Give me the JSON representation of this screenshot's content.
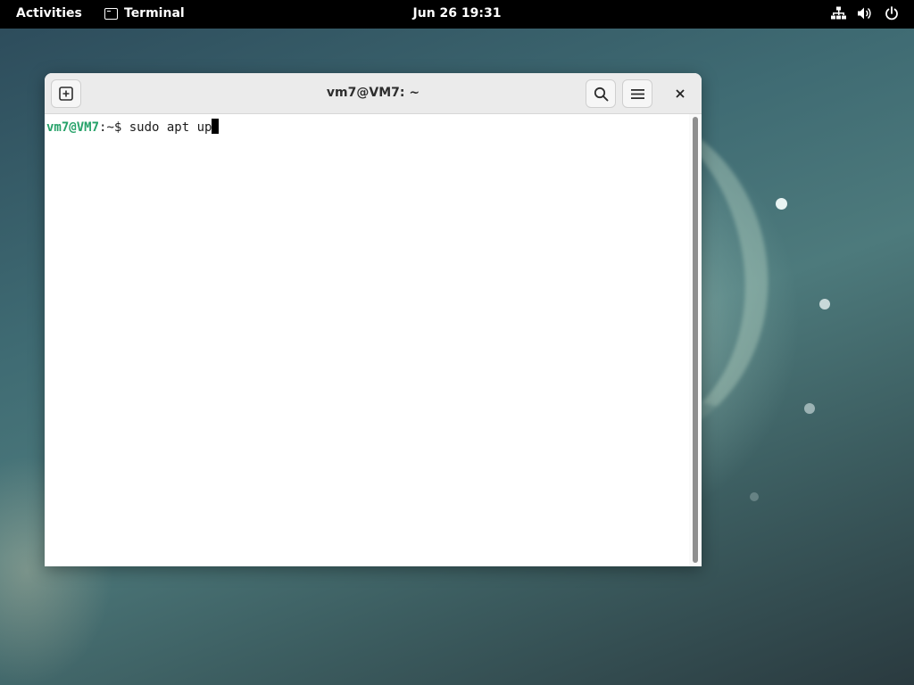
{
  "topbar": {
    "activities_label": "Activities",
    "app_name": "Terminal",
    "clock": "Jun 26  19:31",
    "icons": [
      "network-icon",
      "volume-icon",
      "power-icon"
    ]
  },
  "window": {
    "title": "vm7@VM7: ~",
    "prompt_user": "vm7@VM7",
    "prompt_rest": ":~$ ",
    "command": "sudo apt up"
  },
  "colors": {
    "prompt_green": "#26a269",
    "topbar_bg": "#000000"
  }
}
